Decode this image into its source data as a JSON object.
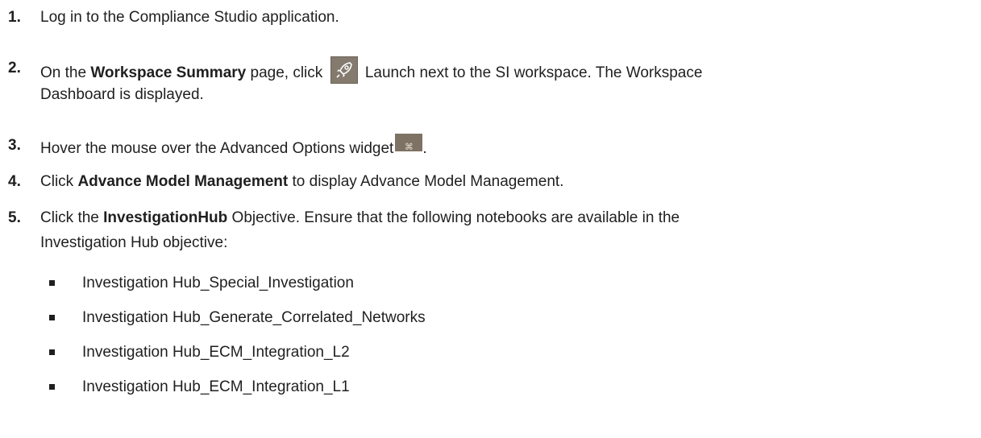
{
  "steps": [
    {
      "num": "1.",
      "text": "Log in to the Compliance Studio application."
    },
    {
      "num": "2.",
      "pre": "On the ",
      "bold": "Workspace Summary",
      "mid": " page, click ",
      "post": " Launch next to the SI workspace. The Workspace",
      "line2": "Dashboard is displayed.",
      "icon": "rocket-icon"
    },
    {
      "num": "3.",
      "text": "Hover the mouse over the Advanced Options widget",
      "suffix": ".",
      "icon": "widget-icon"
    },
    {
      "num": "4.",
      "pre": "Click ",
      "bold": "Advance Model Management",
      "post": " to display Advance Model Management."
    },
    {
      "num": "5.",
      "pre": "Click the ",
      "bold": "InvestigationHub",
      "post": " Objective. Ensure that the following notebooks are available in the",
      "line2": "Investigation Hub objective:"
    }
  ],
  "notebooks": [
    "Investigation Hub_Special_Investigation",
    "Investigation Hub_Generate_Correlated_Networks",
    "Investigation Hub_ECM_Integration_L2",
    "Investigation Hub_ECM_Integration_L1"
  ],
  "widget_icon_glyph": "⌘",
  "colors": {
    "icon_bg": "#847a6e",
    "text": "#1f1f1f"
  }
}
